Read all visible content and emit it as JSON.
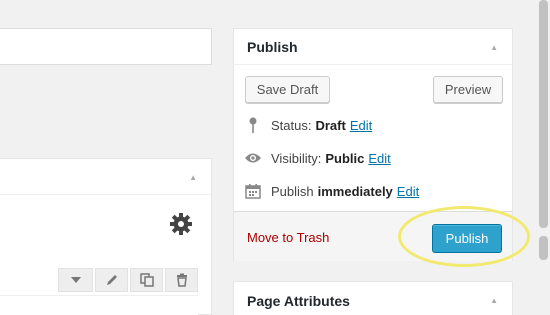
{
  "publish": {
    "title": "Publish",
    "save_draft_label": "Save Draft",
    "preview_label": "Preview",
    "status_label": "Status:",
    "status_value": "Draft",
    "status_edit": "Edit",
    "visibility_label": "Visibility:",
    "visibility_value": "Public",
    "visibility_edit": "Edit",
    "schedule_label": "Publish",
    "schedule_value": "immediately",
    "schedule_edit": "Edit",
    "trash_label": "Move to Trash",
    "publish_button_label": "Publish"
  },
  "page_attributes": {
    "title": "Page Attributes"
  },
  "colors": {
    "primary_button": "#2ea2cc",
    "link": "#0073aa",
    "trash": "#aa0000",
    "highlight": "#f2ea6e"
  },
  "icons": [
    "pin-icon",
    "eye-icon",
    "calendar-icon",
    "gear-icon",
    "dropdown-arrow-icon",
    "pencil-icon",
    "copy-icon",
    "trash-icon",
    "collapse-arrow-icon"
  ]
}
